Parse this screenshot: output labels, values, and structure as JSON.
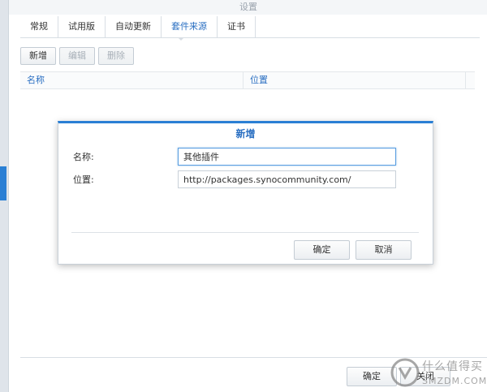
{
  "window": {
    "title": "设置"
  },
  "tabs": [
    {
      "label": "常规"
    },
    {
      "label": "试用版"
    },
    {
      "label": "自动更新"
    },
    {
      "label": "套件来源"
    },
    {
      "label": "证书"
    }
  ],
  "active_tab_index": 3,
  "toolbar": {
    "add_label": "新增",
    "edit_label": "编辑",
    "delete_label": "删除"
  },
  "grid": {
    "columns": [
      "名称",
      "位置"
    ],
    "rows": []
  },
  "footer": {
    "ok_label": "确定",
    "close_label": "关闭"
  },
  "dialog": {
    "title": "新增",
    "name_label": "名称:",
    "name_value": "其他插件",
    "location_label": "位置:",
    "location_value": "http://packages.synocommunity.com/",
    "ok_label": "确定",
    "cancel_label": "取消"
  },
  "watermark": {
    "line1": "什么值得买",
    "line2": "SMZDM.COM"
  },
  "colors": {
    "accent": "#2a7fd4",
    "link_blue": "#2a6fc2"
  }
}
